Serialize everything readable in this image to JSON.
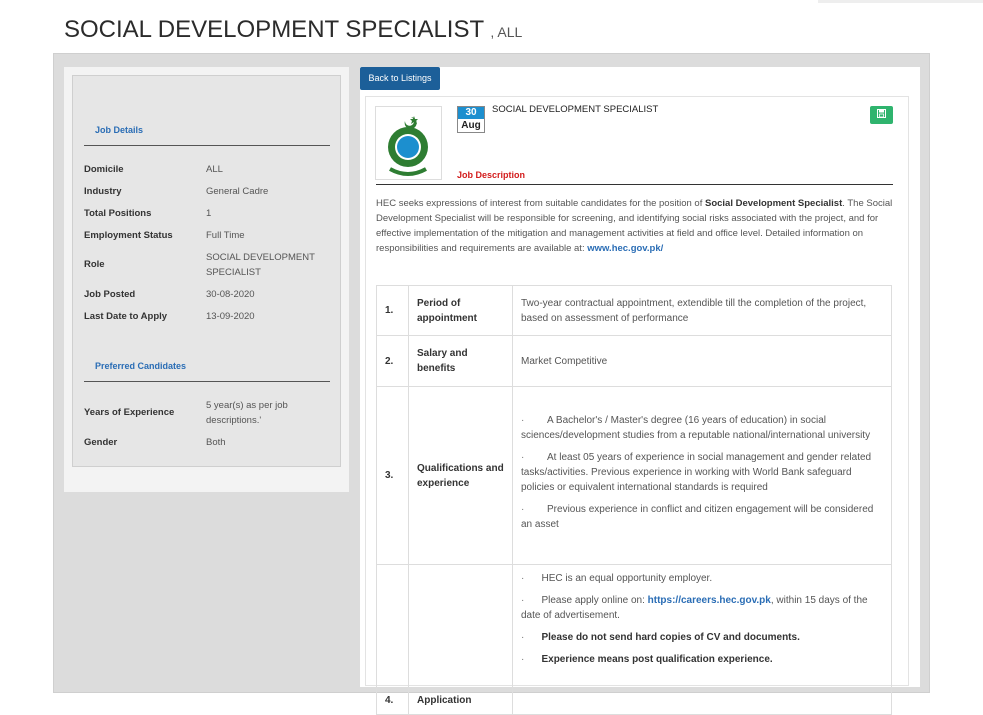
{
  "header": {
    "title": "SOCIAL DEVELOPMENT SPECIALIST",
    "subtitle": ", ALL"
  },
  "sidebar": {
    "job_details_title": "Job Details",
    "details": [
      {
        "label": "Domicile",
        "value": "ALL"
      },
      {
        "label": "Industry",
        "value": "General Cadre"
      },
      {
        "label": "Total Positions",
        "value": "1"
      },
      {
        "label": "Employment Status",
        "value": "Full Time"
      },
      {
        "label": "Role",
        "value": "SOCIAL DEVELOPMENT SPECIALIST"
      },
      {
        "label": "Job Posted",
        "value": "30-08-2020"
      },
      {
        "label": "Last Date to Apply",
        "value": "13-09-2020"
      }
    ],
    "preferred_title": "Preferred Candidates",
    "preferred": [
      {
        "label": "Years of Experience",
        "value": "5 year(s) as per job descriptions.'"
      },
      {
        "label": "Gender",
        "value": "Both"
      }
    ]
  },
  "main": {
    "back_button": "Back to Listings",
    "date_day": "30",
    "date_month": "Aug",
    "job_title": "SOCIAL DEVELOPMENT SPECIALIST",
    "job_description_label": "Job Description",
    "intro": {
      "p1": "HEC seeks expressions of interest from suitable candidates for the position of ",
      "p1_bold": "Social Development Specialist",
      "p2": ". The Social Development Specialist will be responsible for screening, and identifying social risks associated with the project, and for effective implementation of the mitigation and management activities at field and office level. Detailed information on responsibilities and requirements are available at: ",
      "link": "www.hec.gov.pk/"
    },
    "table": {
      "r1": {
        "num": "1.",
        "label": "Period of appointment",
        "value": "Two-year contractual appointment, extendible till the completion of the project, based on assessment of performance"
      },
      "r2": {
        "num": "2.",
        "label": "Salary and benefits",
        "value": "Market Competitive"
      },
      "r3": {
        "num": "3.",
        "label": "Qualifications and experience",
        "b1": "A Bachelor's / Master's degree (16 years of education) in social sciences/development studies from a reputable national/international university",
        "b2": "At least 05 years of experience in social management and gender related tasks/activities. Previous experience in working with World Bank safeguard policies or equivalent international standards is required",
        "b3": "Previous experience in conflict and citizen engagement will be considered an asset"
      },
      "r4": {
        "num": "4.",
        "label": "Application",
        "b1": "HEC is an equal opportunity employer.",
        "b2_pre": "Please apply online on: ",
        "b2_link": "https://careers.hec.gov.pk",
        "b2_post": ", within 15 days of the date of advertisement.",
        "b3": "Please do not send hard copies of CV and documents.",
        "b4": "Experience means post qualification experience."
      }
    }
  }
}
